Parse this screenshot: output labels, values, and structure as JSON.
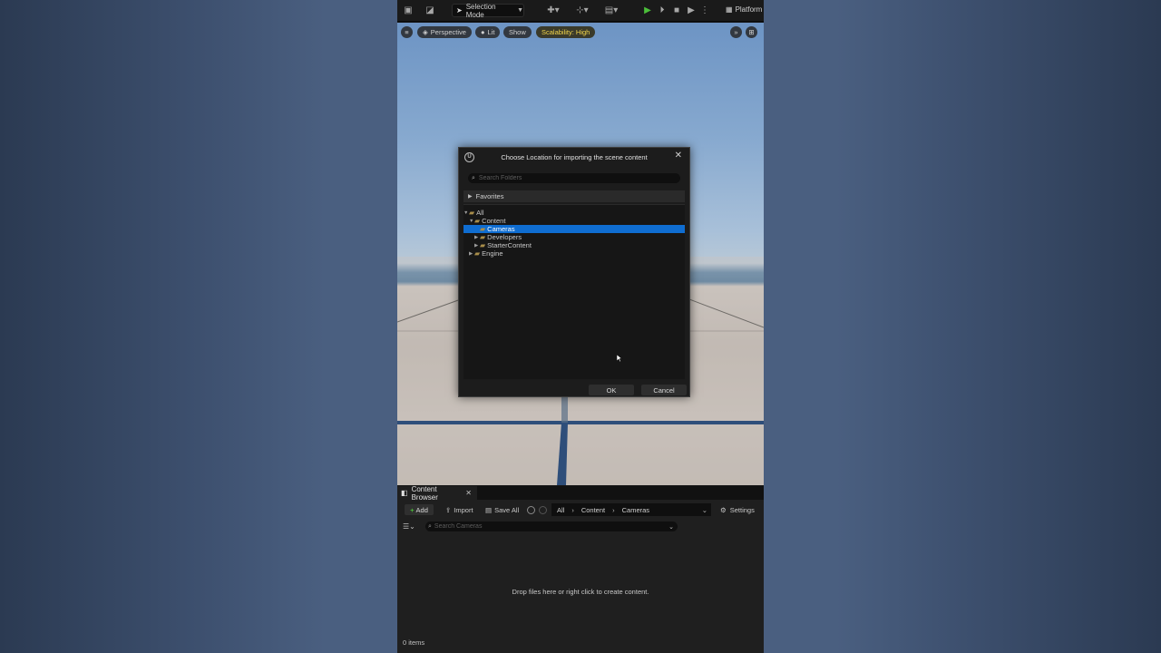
{
  "toolbar": {
    "selection_mode": "Selection Mode",
    "platforms": "Platform"
  },
  "viewport": {
    "perspective": "Perspective",
    "lit": "Lit",
    "show": "Show",
    "scalability": "Scalability: High"
  },
  "dialog": {
    "title": "Choose Location for importing the scene content",
    "search_placeholder": "Search Folders",
    "favorites": "Favorites",
    "tree": {
      "all": "All",
      "content": "Content",
      "cameras": "Cameras",
      "developers": "Developers",
      "starter": "StarterContent",
      "engine": "Engine"
    },
    "ok": "OK",
    "cancel": "Cancel"
  },
  "content_browser": {
    "tab": "Content Browser",
    "add": "Add",
    "import": "Import",
    "save_all": "Save All",
    "breadcrumb": [
      "All",
      "Content",
      "Cameras"
    ],
    "settings": "Settings",
    "search_placeholder": "Search Cameras",
    "drop_message": "Drop files here or right click to create content.",
    "items_count": "0 items"
  },
  "colors": {
    "selection": "#0f6dd1",
    "play_green": "#4bbf3a",
    "scalability_yellow": "#f2d64b"
  }
}
